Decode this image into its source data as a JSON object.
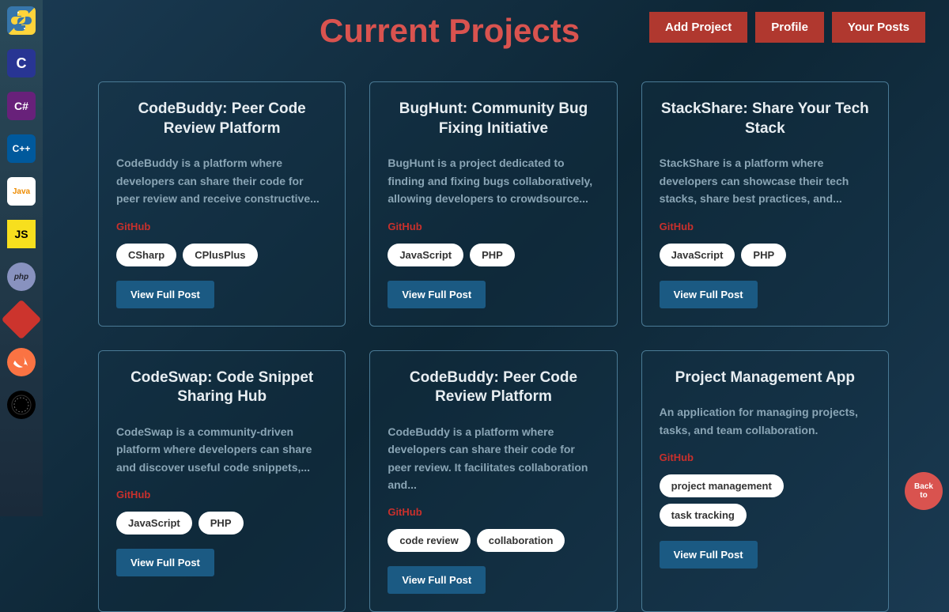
{
  "title": "Current Projects",
  "nav": {
    "add": "Add Project",
    "profile": "Profile",
    "posts": "Your Posts"
  },
  "sidebar": {
    "python": "Py",
    "c": "C",
    "csharp": "C#",
    "cpp": "C++",
    "java": "Java",
    "js": "JS",
    "php": "php",
    "ruby": "",
    "swift": "",
    "rust": "R"
  },
  "github_label": "GitHub",
  "view_label": "View Full Post",
  "fab": {
    "line1": "Back",
    "line2": "to"
  },
  "cards": [
    {
      "title": "CodeBuddy: Peer Code Review Platform",
      "desc": "CodeBuddy is a platform where developers can share their code for peer review and receive constructive...",
      "tags": [
        "CSharp",
        "CPlusPlus"
      ]
    },
    {
      "title": "BugHunt: Community Bug Fixing Initiative",
      "desc": "BugHunt is a project dedicated to finding and fixing bugs collaboratively, allowing developers to crowdsource...",
      "tags": [
        "JavaScript",
        "PHP"
      ]
    },
    {
      "title": "StackShare: Share Your Tech Stack",
      "desc": "StackShare is a platform where developers can showcase their tech stacks, share best practices, and...",
      "tags": [
        "JavaScript",
        "PHP"
      ]
    },
    {
      "title": "CodeSwap: Code Snippet Sharing Hub",
      "desc": "CodeSwap is a community-driven platform where developers can share and discover useful code snippets,...",
      "tags": [
        "JavaScript",
        "PHP"
      ]
    },
    {
      "title": "CodeBuddy: Peer Code Review Platform",
      "desc": "CodeBuddy is a platform where developers can share their code for peer review. It facilitates collaboration and...",
      "tags": [
        "code review",
        "collaboration"
      ]
    },
    {
      "title": "Project Management App",
      "desc": "An application for managing projects, tasks, and team collaboration.",
      "tags": [
        "project management",
        "task tracking"
      ]
    }
  ]
}
